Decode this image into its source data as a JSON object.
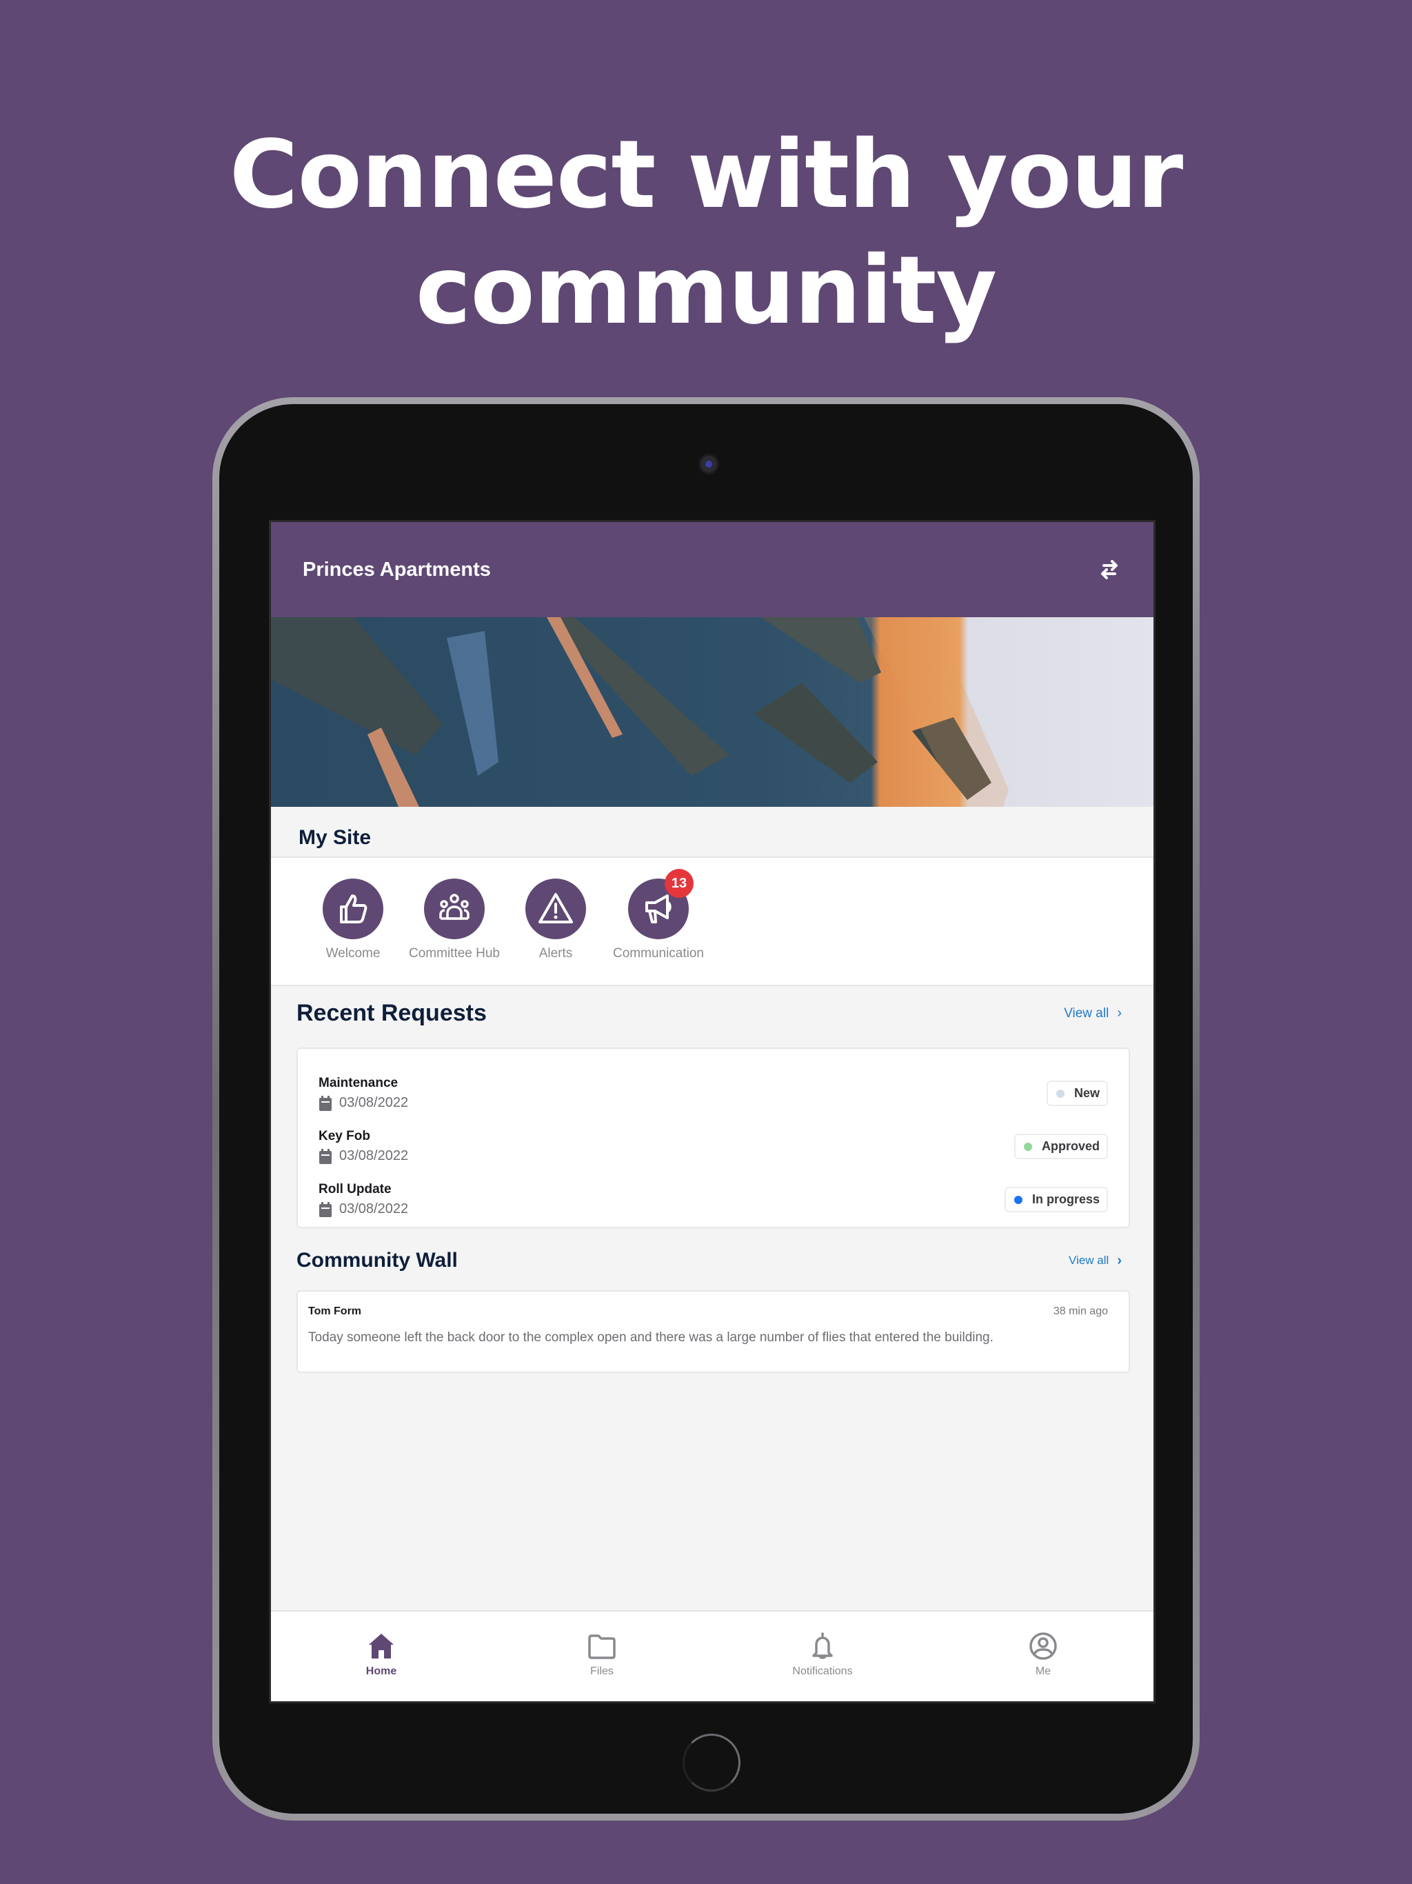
{
  "headline": [
    "Connect with your",
    "community"
  ],
  "app": {
    "title": "Princes Apartments",
    "switch_icon": "swap-arrows-icon"
  },
  "my_site": {
    "title": "My Site",
    "tiles": [
      {
        "label": "Welcome",
        "icon": "thumbs-up-icon"
      },
      {
        "label": "Committee Hub",
        "icon": "group-icon"
      },
      {
        "label": "Alerts",
        "icon": "warning-icon"
      },
      {
        "label": "Communication",
        "icon": "megaphone-icon",
        "badge": "13"
      }
    ]
  },
  "recent_requests": {
    "title": "Recent Requests",
    "view_all": "View all",
    "items": [
      {
        "name": "Maintenance",
        "date": "03/08/2022",
        "status": "New",
        "status_color": "#d3dde8"
      },
      {
        "name": "Key Fob",
        "date": "03/08/2022",
        "status": "Approved",
        "status_color": "#93d69a"
      },
      {
        "name": "Roll Update",
        "date": "03/08/2022",
        "status": "In progress",
        "status_color": "#1d74f0"
      }
    ]
  },
  "community_wall": {
    "title": "Community Wall",
    "view_all": "View all",
    "posts": [
      {
        "author": "Tom Form",
        "time": "38 min ago",
        "text": "Today someone left the back door to the complex open and there was a large number of flies that entered the building."
      }
    ]
  },
  "tabbar": {
    "tabs": [
      {
        "label": "Home",
        "icon": "home-icon",
        "active": true
      },
      {
        "label": "Files",
        "icon": "folder-icon"
      },
      {
        "label": "Notifications",
        "icon": "bell-icon"
      },
      {
        "label": "Me",
        "icon": "user-circle-icon"
      }
    ]
  },
  "colors": {
    "brand": "#5f4873",
    "link": "#2079c7",
    "badge": "#e5363c",
    "heading": "#0f1f3a"
  }
}
